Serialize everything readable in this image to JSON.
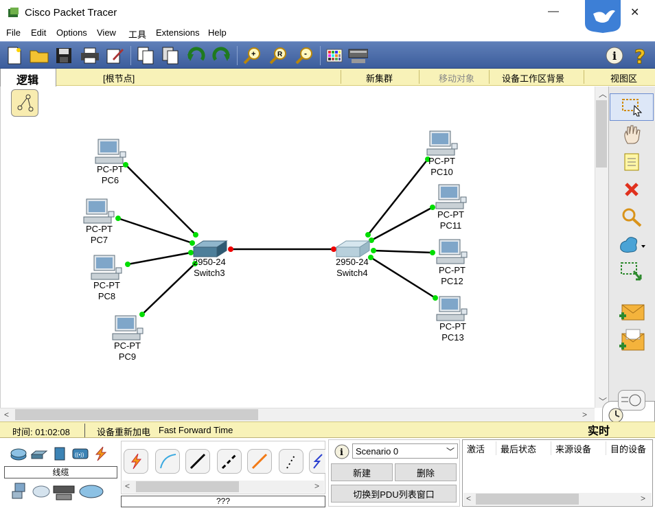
{
  "window": {
    "title": "Cisco Packet Tracer",
    "minimize": "—",
    "close": "✕"
  },
  "menu": [
    "File",
    "Edit",
    "Options",
    "View",
    "工具",
    "Extensions",
    "Help"
  ],
  "logic_bar": {
    "tab_label": "逻辑",
    "root_node": "[根节点]",
    "new_cluster": "新集群",
    "move_object": "移动对象",
    "workspace_background": "设备工作区背景",
    "viewport": "视图区"
  },
  "devices": [
    {
      "id": "pc6",
      "model": "PC-PT",
      "name": "PC6"
    },
    {
      "id": "pc7",
      "model": "PC-PT",
      "name": "PC7"
    },
    {
      "id": "pc8",
      "model": "PC-PT",
      "name": "PC8"
    },
    {
      "id": "pc9",
      "model": "PC-PT",
      "name": "PC9"
    },
    {
      "id": "pc10",
      "model": "PC-PT",
      "name": "PC10"
    },
    {
      "id": "pc11",
      "model": "PC-PT",
      "name": "PC11"
    },
    {
      "id": "pc12",
      "model": "PC-PT",
      "name": "PC12"
    },
    {
      "id": "pc13",
      "model": "PC-PT",
      "name": "PC13"
    },
    {
      "id": "switch3",
      "model": "2950-24",
      "name": "Switch3"
    },
    {
      "id": "switch4",
      "model": "2950-24",
      "name": "Switch4"
    }
  ],
  "status_bar": {
    "time_label": "时间: 01:02:08",
    "power_cycle": "设备重新加电",
    "fast_forward": "Fast Forward Time",
    "mode_label": "实时"
  },
  "device_panel": {
    "category_label": "线缆",
    "cable_status": "???"
  },
  "scenario": {
    "selected": "Scenario 0",
    "new_button": "新建",
    "delete_button": "删除",
    "toggle_pdu_button": "切换到PDU列表窗口"
  },
  "pdu_table": {
    "columns": [
      "激活",
      "最后状态",
      "来源设备",
      "目的设备"
    ]
  },
  "colors": {
    "toolbar": "#4a6aa8",
    "logic_bar": "#f8f2b8",
    "link_up": "#00dd00",
    "link_down": "#ee0000"
  }
}
